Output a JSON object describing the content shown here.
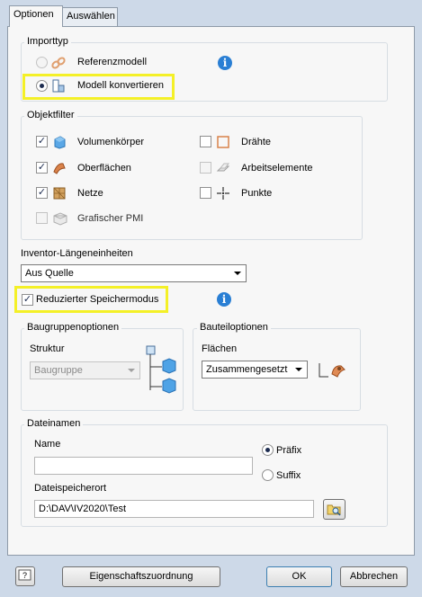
{
  "tabs": [
    {
      "label": "Optionen",
      "active": true
    },
    {
      "label": "Auswählen",
      "active": false
    }
  ],
  "import_type": {
    "legend": "Importtyp",
    "options": [
      {
        "label": "Referenzmodell",
        "selected": false
      },
      {
        "label": "Modell konvertieren",
        "selected": true
      }
    ],
    "info_icon": "info-icon"
  },
  "object_filter": {
    "legend": "Objektfilter",
    "items": [
      {
        "label": "Volumenkörper",
        "checked": true,
        "enabled": true
      },
      {
        "label": "Oberflächen",
        "checked": true,
        "enabled": true
      },
      {
        "label": "Netze",
        "checked": true,
        "enabled": true
      },
      {
        "label": "Grafischer PMI",
        "checked": false,
        "enabled": false
      },
      {
        "label": "Drähte",
        "checked": false,
        "enabled": true
      },
      {
        "label": "Arbeitselemente",
        "checked": false,
        "enabled": false
      },
      {
        "label": "Punkte",
        "checked": false,
        "enabled": true
      }
    ]
  },
  "units": {
    "label": "Inventor-Längeneinheiten",
    "value": "Aus Quelle"
  },
  "reduced_memory": {
    "label": "Reduzierter Speichermodus",
    "checked": true
  },
  "assembly_options": {
    "legend": "Baugruppenoptionen",
    "structure_label": "Struktur",
    "structure_value": "Baugruppe"
  },
  "part_options": {
    "legend": "Bauteiloptionen",
    "surfaces_label": "Flächen",
    "surfaces_value": "Zusammengesetzt"
  },
  "file_names": {
    "legend": "Dateinamen",
    "name_label": "Name",
    "name_value": "",
    "prefix_label": "Präfix",
    "suffix_label": "Suffix",
    "prefix_selected": true,
    "location_label": "Dateispeicherort",
    "location_value": "D:\\DAV\\IV2020\\Test"
  },
  "footer": {
    "help_icon": "help-icon",
    "mapping_button": "Eigenschaftszuordnung",
    "ok_button": "OK",
    "cancel_button": "Abbrechen"
  },
  "colors": {
    "highlight": "#f4f027",
    "info_blue": "#2a7fd4",
    "solid_blue": "#5aa7e6",
    "surface_orange": "#d9824a"
  }
}
